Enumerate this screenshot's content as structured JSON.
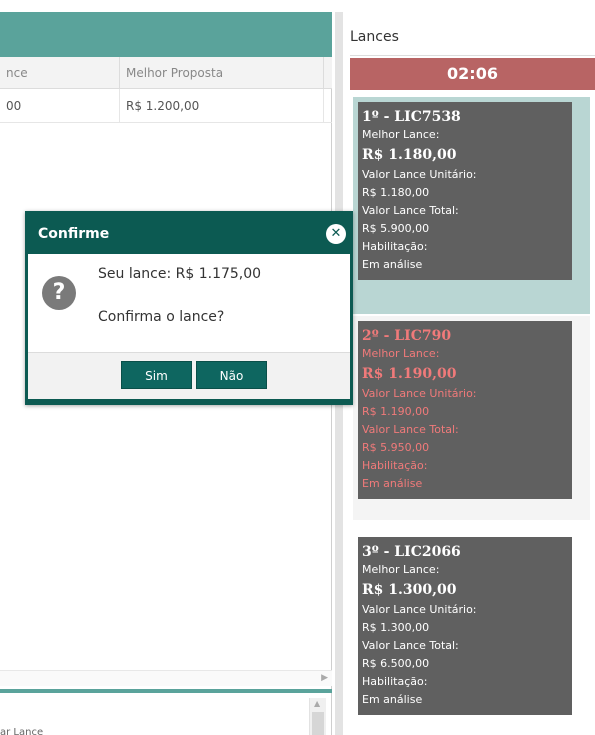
{
  "left_panel": {
    "column_headers": [
      "nce",
      "Melhor Proposta"
    ],
    "row": [
      "00",
      "R$ 1.200,00"
    ],
    "bottom_text": "ar Lance"
  },
  "right_panel": {
    "title": "Lances",
    "timer": "02:06",
    "bids": [
      {
        "title": "1º - LIC7538",
        "best_label": "Melhor Lance:",
        "best_value": "R$ 1.180,00",
        "unit_label": "Valor Lance Unitário:",
        "unit_value": "R$ 1.180,00",
        "total_label": "Valor Lance Total:",
        "total_value": "R$ 5.900,00",
        "hab_label": "Habilitação:",
        "hab_value": "Em análise"
      },
      {
        "title": "2º - LIC790",
        "best_label": "Melhor Lance:",
        "best_value": "R$ 1.190,00",
        "unit_label": "Valor Lance Unitário:",
        "unit_value": "R$ 1.190,00",
        "total_label": "Valor Lance Total:",
        "total_value": "R$ 5.950,00",
        "hab_label": "Habilitação:",
        "hab_value": "Em análise"
      },
      {
        "title": "3º - LIC2066",
        "best_label": "Melhor Lance:",
        "best_value": "R$ 1.300,00",
        "unit_label": "Valor Lance Unitário:",
        "unit_value": "R$ 1.300,00",
        "total_label": "Valor Lance Total:",
        "total_value": "R$ 6.500,00",
        "hab_label": "Habilitação:",
        "hab_value": "Em análise"
      }
    ]
  },
  "modal": {
    "title": "Confirme",
    "message": "Seu lance: R$ 1.175,00",
    "question": "Confirma o lance?",
    "yes_label": "Sim",
    "no_label": "Não",
    "icon": "question-icon",
    "close_icon": "close-icon"
  },
  "colors": {
    "header_teal": "#5aa39b",
    "modal_dark_teal": "#0c5a52",
    "button_teal": "#0e6660",
    "timer_red": "#b86464",
    "card_gray": "#606060",
    "second_place_text": "#f07a7a"
  }
}
